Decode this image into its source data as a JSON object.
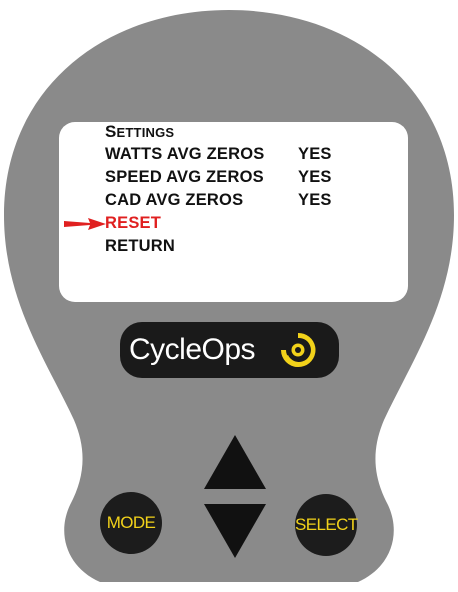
{
  "device": {
    "body_color": "#8a8a8a",
    "screen": {
      "menu_title_first": "S",
      "menu_title_rest": "ETTINGS",
      "items": [
        {
          "label": "WATTS AVG ZEROS",
          "value": "YES"
        },
        {
          "label": "SPEED AVG ZEROS",
          "value": "YES"
        },
        {
          "label": "CAD AVG ZEROS",
          "value": "YES"
        },
        {
          "label": "RESET",
          "value": ""
        },
        {
          "label": "RETURN",
          "value": ""
        }
      ],
      "selected_index": 3,
      "selected_color": "#e02020"
    },
    "logo": {
      "text": "CycleOps",
      "icon": "cycleops-swirl-icon",
      "accent": "#f2d21a"
    },
    "buttons": {
      "mode_label": "MODE",
      "select_label": "SELECT",
      "up_icon": "triangle-up-icon",
      "down_icon": "triangle-down-icon",
      "label_color": "#f2d21a"
    }
  }
}
